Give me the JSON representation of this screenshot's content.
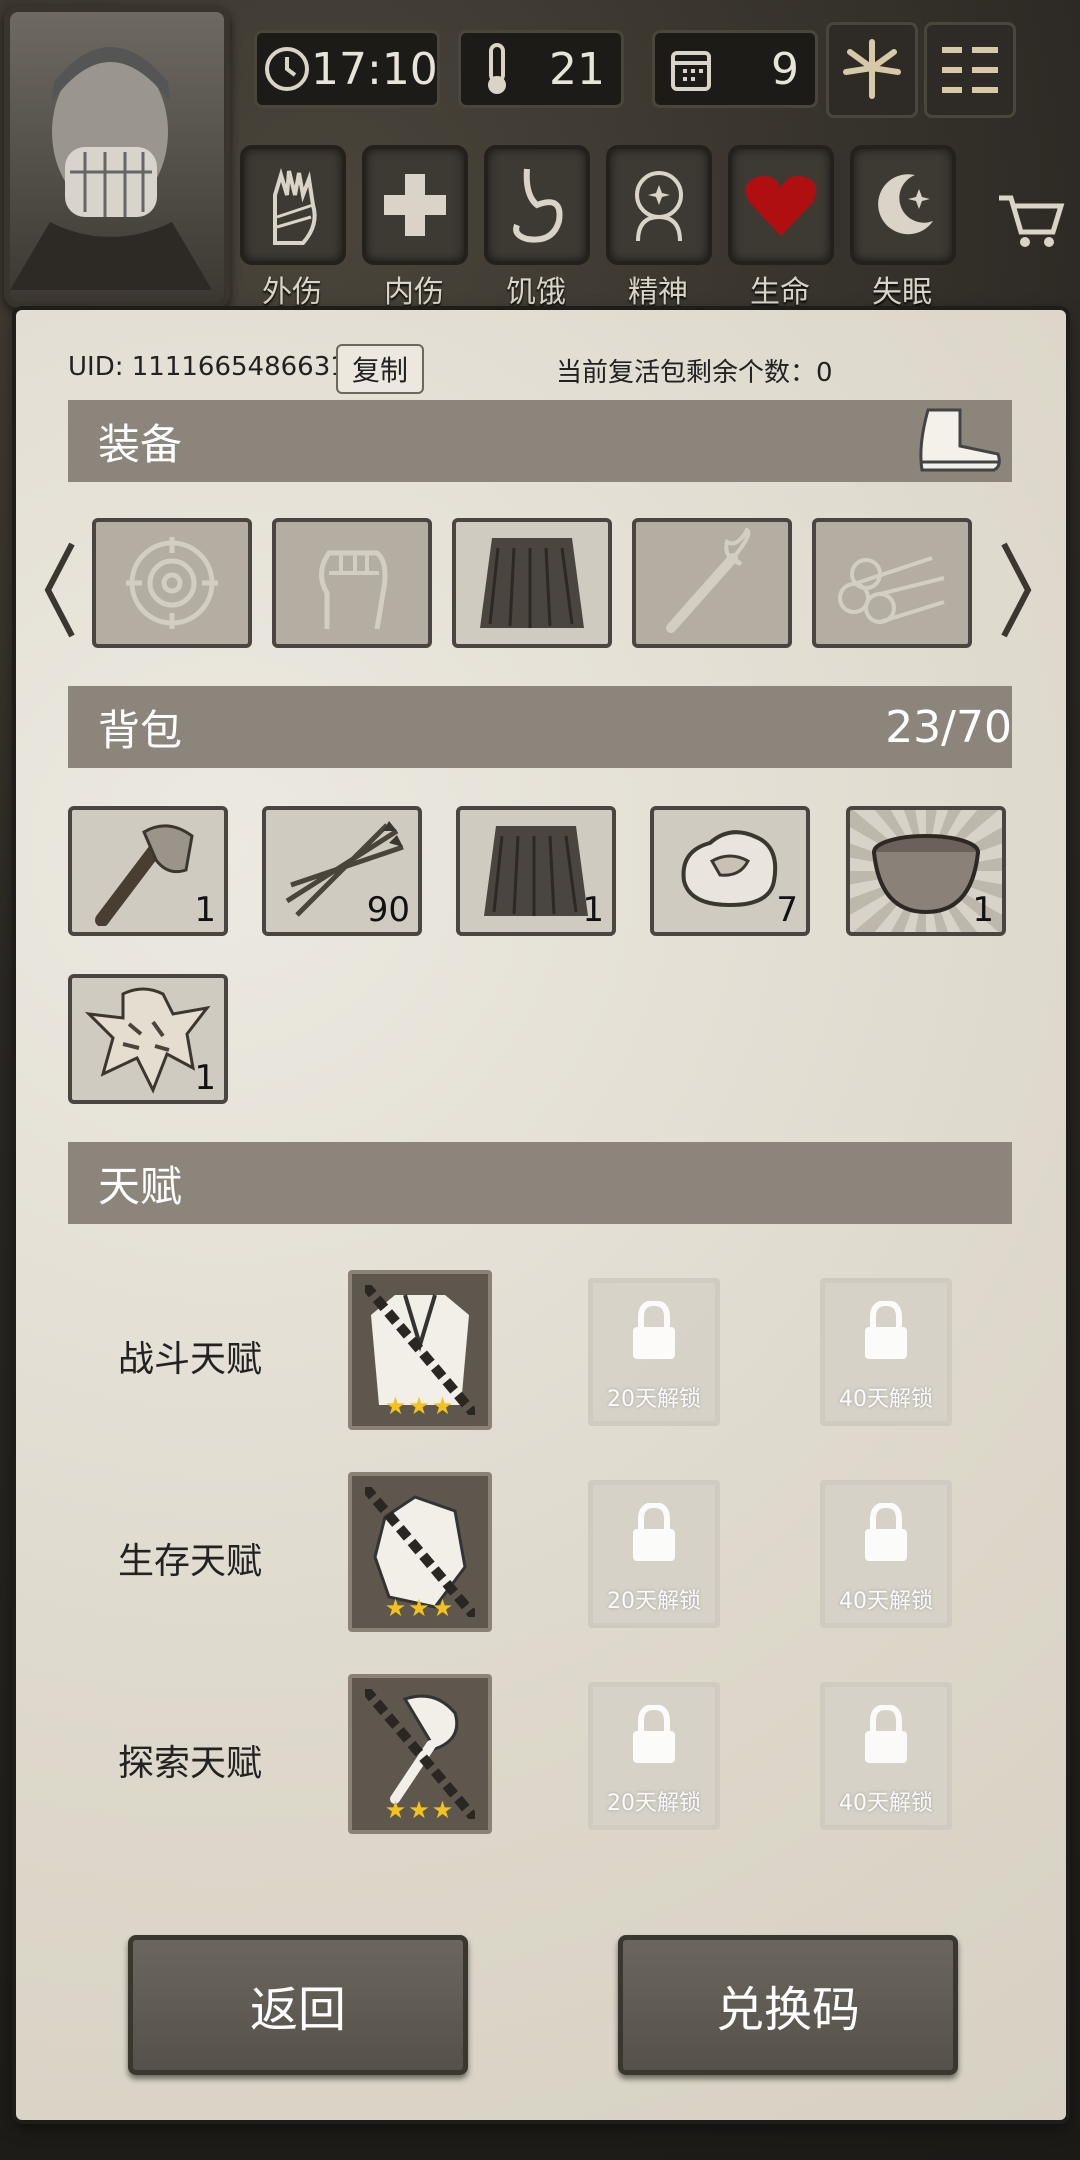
{
  "hud": {
    "time": "17:10",
    "temperature": "21",
    "day": "9",
    "icons": {
      "clock": "clock-icon",
      "thermometer": "thermometer-icon",
      "calendar": "calendar-icon",
      "leaf": "leaf-icon",
      "menu": "menu-icon"
    }
  },
  "status": [
    {
      "label": "外伤",
      "icon": "bandaged-hand-icon"
    },
    {
      "label": "内伤",
      "icon": "cross-icon"
    },
    {
      "label": "饥饿",
      "icon": "stomach-icon"
    },
    {
      "label": "精神",
      "icon": "head-icon"
    },
    {
      "label": "生命",
      "icon": "heart-icon"
    },
    {
      "label": "失眠",
      "icon": "moon-star-icon"
    }
  ],
  "account": {
    "uid": "UID: 1111665486631",
    "copy_label": "复制",
    "revive_text": "当前复活包剩余个数：0"
  },
  "equipment": {
    "title": "装备",
    "slots": [
      "target",
      "fist",
      "skirt",
      "torch",
      "logs"
    ]
  },
  "backpack": {
    "title": "背包",
    "capacity": "23/70",
    "items": [
      {
        "name": "stone-axe",
        "count": "1"
      },
      {
        "name": "arrows",
        "count": "90"
      },
      {
        "name": "grass-skirt",
        "count": "1"
      },
      {
        "name": "raw-meat",
        "count": "7"
      },
      {
        "name": "wooden-bowl",
        "count": "1"
      },
      {
        "name": "tiger-pelt",
        "count": "1"
      }
    ]
  },
  "talents": {
    "title": "天赋",
    "rows": [
      {
        "label": "战斗天赋",
        "icon": "uniform-icon",
        "lock1": "20天解锁",
        "lock2": "40天解锁"
      },
      {
        "label": "生存天赋",
        "icon": "stone-icon",
        "lock1": "20天解锁",
        "lock2": "40天解锁"
      },
      {
        "label": "探索天赋",
        "icon": "shovel-icon",
        "lock1": "20天解锁",
        "lock2": "40天解锁"
      }
    ],
    "stars": "★★★"
  },
  "buttons": {
    "back": "返回",
    "redeem": "兑换码"
  }
}
